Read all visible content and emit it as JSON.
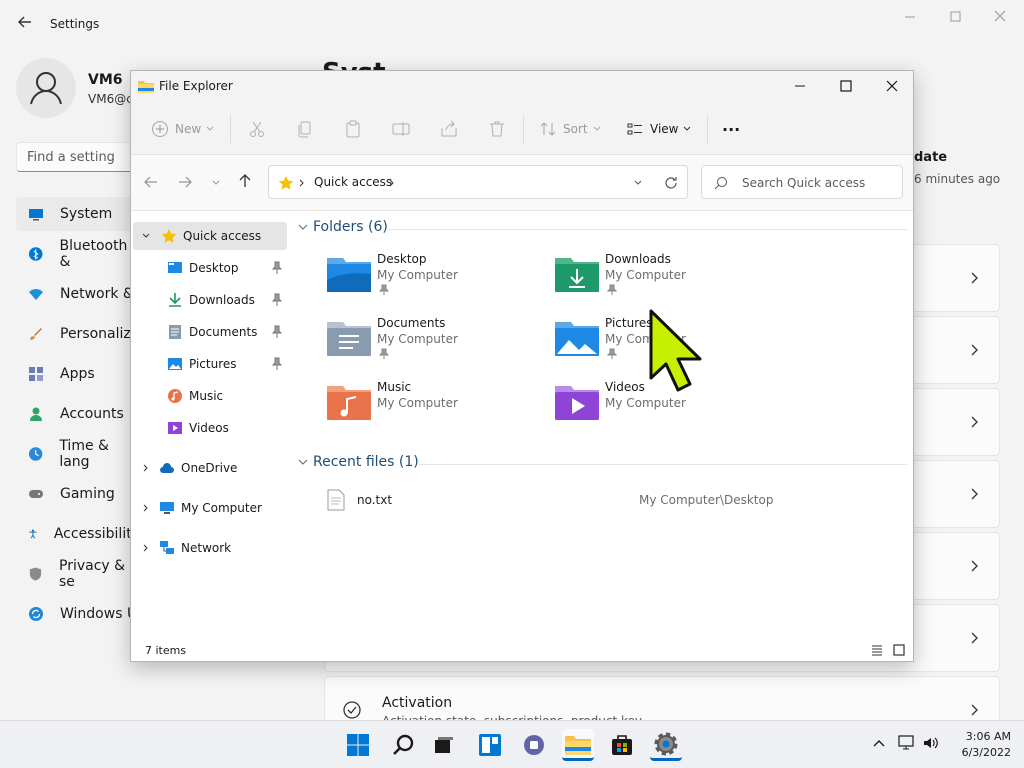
{
  "settings": {
    "title": "Settings",
    "account_name": "VM6",
    "account_email": "VM6@c",
    "search_placeholder": "Find a setting",
    "page_heading": "Syst",
    "nav": [
      {
        "label": "System",
        "icon": "system-icon"
      },
      {
        "label": "Bluetooth &",
        "icon": "bluetooth-icon"
      },
      {
        "label": "Network &",
        "icon": "network-icon"
      },
      {
        "label": "Personaliza",
        "icon": "brush-icon"
      },
      {
        "label": "Apps",
        "icon": "apps-icon"
      },
      {
        "label": "Accounts",
        "icon": "accounts-icon"
      },
      {
        "label": "Time & lang",
        "icon": "clock-icon"
      },
      {
        "label": "Gaming",
        "icon": "gamepad-icon"
      },
      {
        "label": "Accessibility",
        "icon": "accessibility-icon"
      },
      {
        "label": "Privacy & se",
        "icon": "shield-icon"
      },
      {
        "label": "Windows U",
        "icon": "update-icon"
      }
    ],
    "update_title": "date",
    "update_sub": "6 minutes ago",
    "activation_title": "Activation",
    "activation_sub": "Activation state, subscriptions, product key"
  },
  "explorer": {
    "title": "File Explorer",
    "toolbar": {
      "new_label": "New",
      "sort_label": "Sort",
      "view_label": "View",
      "more_label": "···"
    },
    "address": "Quick access",
    "search_placeholder": "Search Quick access",
    "tree": {
      "quick_access": "Quick access",
      "pinned": [
        {
          "label": "Desktop",
          "icon": "desktop-icon",
          "pinned": true
        },
        {
          "label": "Downloads",
          "icon": "downloads-icon",
          "pinned": true
        },
        {
          "label": "Documents",
          "icon": "documents-icon",
          "pinned": true
        },
        {
          "label": "Pictures",
          "icon": "pictures-icon",
          "pinned": true
        },
        {
          "label": "Music",
          "icon": "music-icon",
          "pinned": false
        },
        {
          "label": "Videos",
          "icon": "videos-icon",
          "pinned": false
        }
      ],
      "onedrive": "OneDrive",
      "my_computer": "My Computer",
      "network": "Network"
    },
    "folders_heading": "Folders (6)",
    "folders": [
      {
        "name": "Desktop",
        "location": "My Computer",
        "pinned": true
      },
      {
        "name": "Downloads",
        "location": "My Computer",
        "pinned": true
      },
      {
        "name": "Documents",
        "location": "My Computer",
        "pinned": true
      },
      {
        "name": "Pictures",
        "location": "My Computer",
        "pinned": true
      },
      {
        "name": "Music",
        "location": "My Computer",
        "pinned": false
      },
      {
        "name": "Videos",
        "location": "My Computer",
        "pinned": false
      }
    ],
    "recent_heading": "Recent files (1)",
    "recent_files": [
      {
        "name": "no.txt",
        "path": "My Computer\\Desktop"
      }
    ],
    "status": "7 items"
  },
  "taskbar": {
    "time": "3:06 AM",
    "date": "6/3/2022"
  },
  "colors": {
    "accent": "#0067c0",
    "folder_yellow": "#f5c34b",
    "cursor": "#c6f000"
  }
}
